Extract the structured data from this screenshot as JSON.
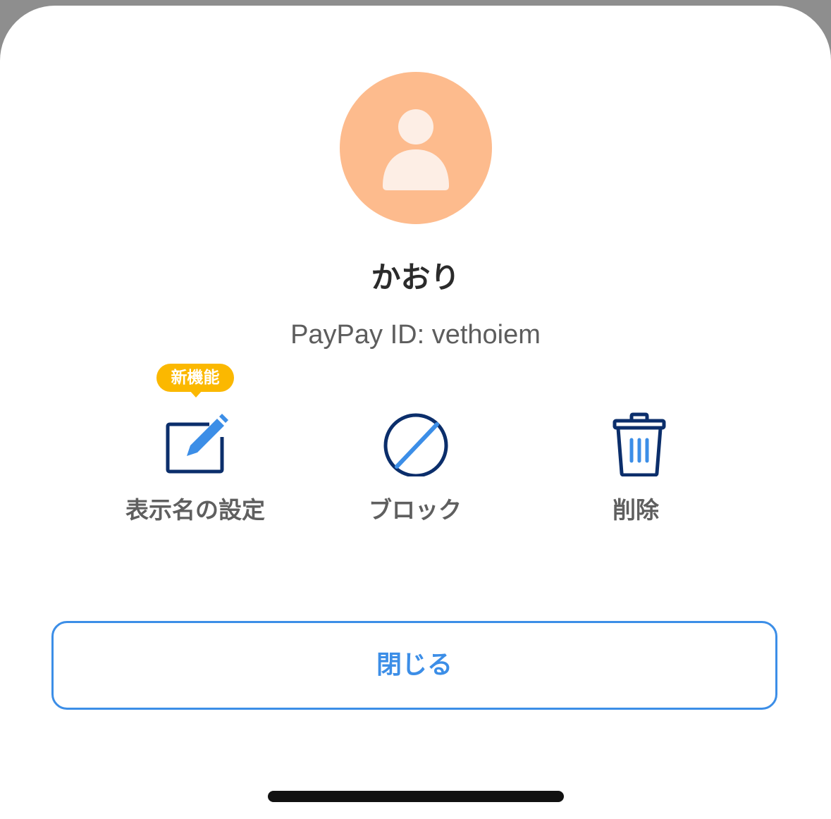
{
  "profile": {
    "name": "かおり",
    "paypay_id": "PayPay ID: vethoiem",
    "avatar_icon": "person-icon",
    "avatar_color": "#fdbb8d"
  },
  "actions": [
    {
      "label": "表示名の設定",
      "icon": "edit-icon",
      "badge": "新機能"
    },
    {
      "label": "ブロック",
      "icon": "block-icon"
    },
    {
      "label": "削除",
      "icon": "trash-icon"
    }
  ],
  "footer": {
    "close_label": "閉じる"
  },
  "colors": {
    "accent": "#3c8ee7",
    "icon_dark": "#0b2e6b",
    "badge": "#fbb800"
  }
}
